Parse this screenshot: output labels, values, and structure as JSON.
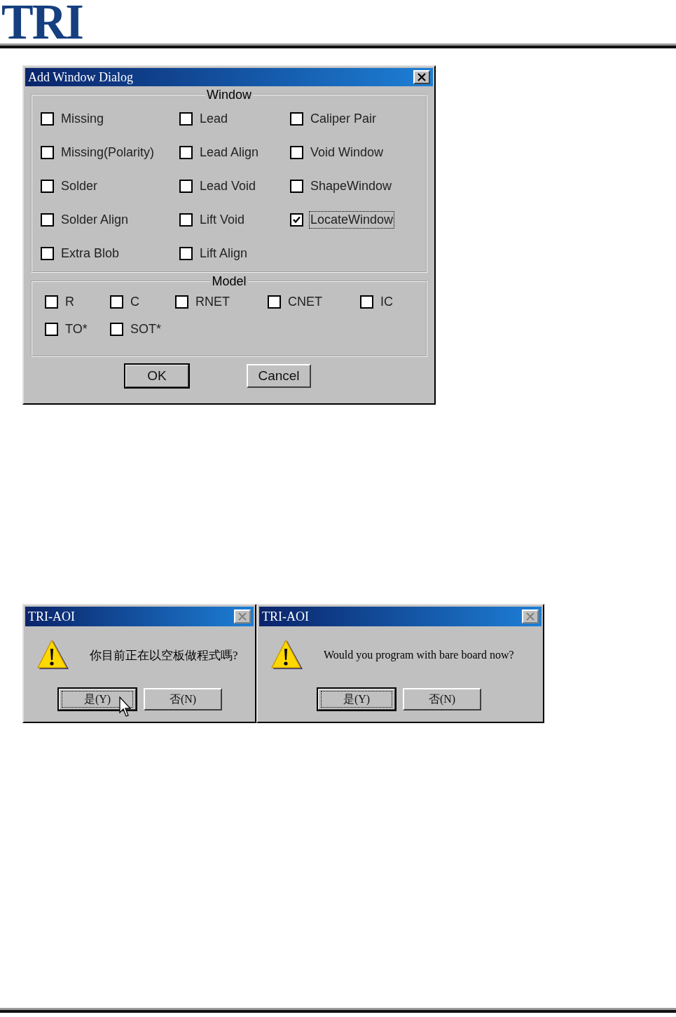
{
  "logo": {
    "text": "TRI"
  },
  "add_window_dialog": {
    "title": "Add Window Dialog",
    "window_group": {
      "label": "Window",
      "options": [
        {
          "label": "Missing",
          "checked": false,
          "focused": false
        },
        {
          "label": "Lead",
          "checked": false,
          "focused": false
        },
        {
          "label": "Caliper Pair",
          "checked": false,
          "focused": false
        },
        {
          "label": "Missing(Polarity)",
          "checked": false,
          "focused": false
        },
        {
          "label": "Lead Align",
          "checked": false,
          "focused": false
        },
        {
          "label": "Void Window",
          "checked": false,
          "focused": false
        },
        {
          "label": "Solder",
          "checked": false,
          "focused": false
        },
        {
          "label": "Lead Void",
          "checked": false,
          "focused": false
        },
        {
          "label": "ShapeWindow",
          "checked": false,
          "focused": false
        },
        {
          "label": "Solder Align",
          "checked": false,
          "focused": false
        },
        {
          "label": "Lift Void",
          "checked": false,
          "focused": false
        },
        {
          "label": "LocateWindow",
          "checked": true,
          "focused": true
        },
        {
          "label": "Extra Blob",
          "checked": false,
          "focused": false
        },
        {
          "label": "Lift Align",
          "checked": false,
          "focused": false
        }
      ]
    },
    "model_group": {
      "label": "Model",
      "options": [
        {
          "label": "R",
          "checked": false
        },
        {
          "label": "C",
          "checked": false
        },
        {
          "label": "RNET",
          "checked": false
        },
        {
          "label": "CNET",
          "checked": false
        },
        {
          "label": "IC",
          "checked": false
        },
        {
          "label": "TO*",
          "checked": false
        },
        {
          "label": "SOT*",
          "checked": false
        }
      ]
    },
    "buttons": [
      {
        "label": "OK",
        "default": true
      },
      {
        "label": "Cancel",
        "default": false
      }
    ]
  },
  "message_boxes": [
    {
      "title": "TRI-AOI",
      "message": "你目前正在以空板做程式嗎?",
      "cursor_visible": true,
      "buttons": [
        {
          "label": "是(Y)",
          "default": true
        },
        {
          "label": "否(N)",
          "default": false
        }
      ]
    },
    {
      "title": "TRI-AOI",
      "message": "Would you program with bare board now?",
      "cursor_visible": false,
      "buttons": [
        {
          "label": "是(Y)",
          "default": true
        },
        {
          "label": "否(N)",
          "default": false
        }
      ]
    }
  ]
}
